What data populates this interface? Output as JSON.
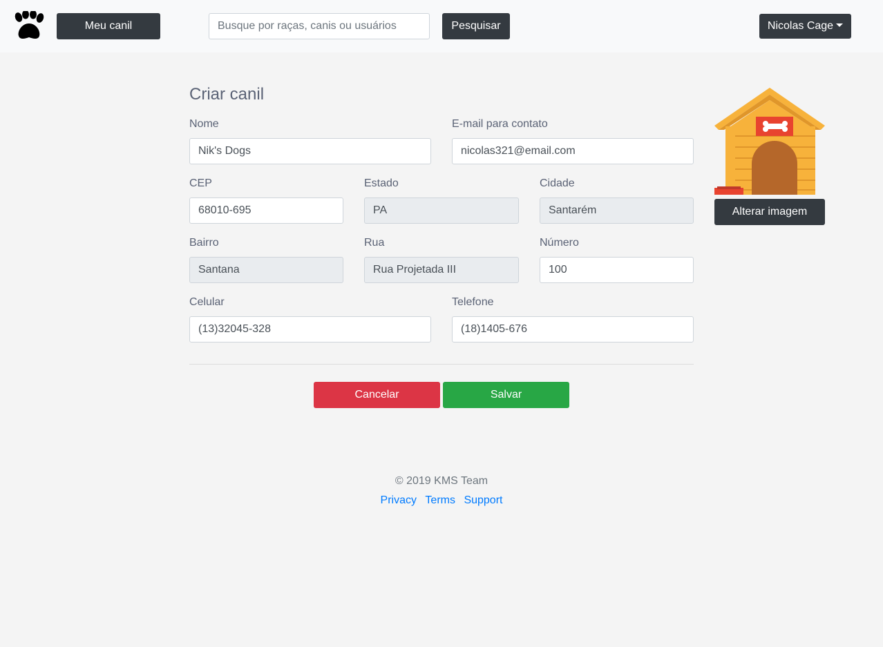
{
  "navbar": {
    "logo_icon": "paw-icon",
    "my_kennel_label": "Meu canil",
    "search_placeholder": "Busque por raças, canis ou usuários",
    "search_button_label": "Pesquisar",
    "user_name": "Nicolas Cage",
    "user_menu_icon": "caret-down-icon"
  },
  "form": {
    "title": "Criar canil",
    "nome": {
      "label": "Nome",
      "value": "Nik's Dogs"
    },
    "email": {
      "label": "E-mail para contato",
      "value": "nicolas321@email.com"
    },
    "cep": {
      "label": "CEP",
      "value": "68010-695"
    },
    "estado": {
      "label": "Estado",
      "value": "PA"
    },
    "cidade": {
      "label": "Cidade",
      "value": "Santarém"
    },
    "bairro": {
      "label": "Bairro",
      "value": "Santana"
    },
    "rua": {
      "label": "Rua",
      "value": "Rua Projetada III"
    },
    "numero": {
      "label": "Número",
      "value": "100"
    },
    "celular": {
      "label": "Celular",
      "value": "(13)32045-328"
    },
    "telefone": {
      "label": "Telefone",
      "value": "(18)1405-676"
    },
    "cancel_label": "Cancelar",
    "save_label": "Salvar"
  },
  "image_panel": {
    "image_icon": "doghouse-icon",
    "change_image_label": "Alterar imagem"
  },
  "footer": {
    "copyright": "© 2019 KMS Team",
    "links": [
      "Privacy",
      "Terms",
      "Support"
    ]
  },
  "colors": {
    "dark": "#343a40",
    "danger": "#dc3545",
    "success": "#28a745",
    "link": "#007bff"
  }
}
